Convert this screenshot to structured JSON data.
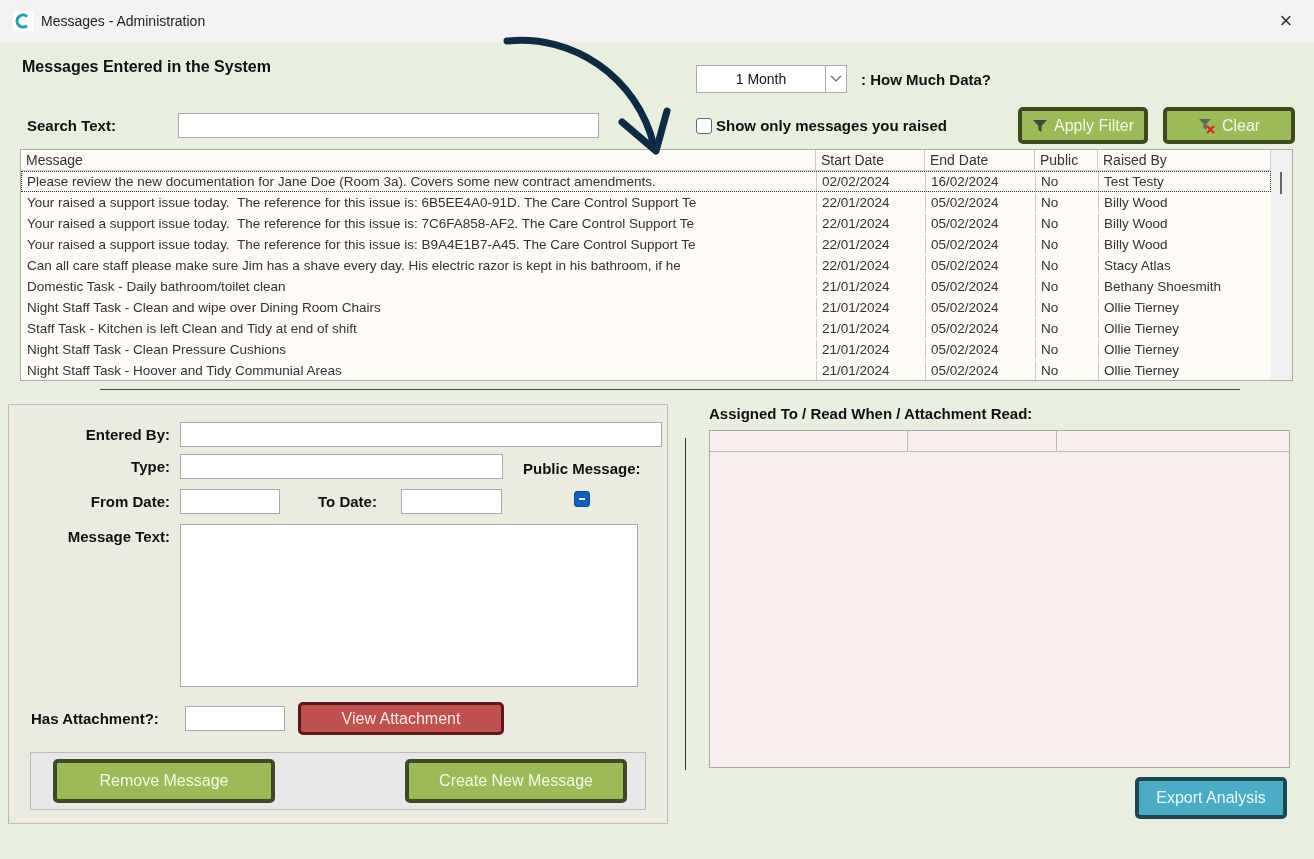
{
  "window": {
    "title": "Messages - Administration",
    "close": "×"
  },
  "header": {
    "title": "Messages Entered in the System"
  },
  "period": {
    "value": "1 Month",
    "label": ": How Much Data?"
  },
  "search": {
    "label": "Search Text:"
  },
  "only_mine": {
    "label": "Show only messages you raised",
    "checked": false
  },
  "filter_buttons": [
    {
      "kind": "apply",
      "label": "Apply Filter"
    },
    {
      "kind": "clear",
      "label": "Clear"
    }
  ],
  "table": {
    "columns": [
      "Message",
      "Start Date",
      "End Date",
      "Public",
      "Raised By"
    ],
    "rows": [
      {
        "selected": true,
        "cells": [
          "Please review the new documentation for Jane Doe (Room 3a). Covers some new contract amendments.",
          "02/02/2024",
          "16/02/2024",
          "No",
          "Test Testy"
        ]
      },
      {
        "selected": false,
        "cells": [
          "Your raised a support issue today.  The reference for this issue is: 6B5EE4A0-91D. The Care Control Support Te",
          "22/01/2024",
          "05/02/2024",
          "No",
          "Billy Wood"
        ]
      },
      {
        "selected": false,
        "cells": [
          "Your raised a support issue today.  The reference for this issue is: 7C6FA858-AF2. The Care Control Support Te",
          "22/01/2024",
          "05/02/2024",
          "No",
          "Billy Wood"
        ]
      },
      {
        "selected": false,
        "cells": [
          "Your raised a support issue today.  The reference for this issue is: B9A4E1B7-A45. The Care Control Support Te",
          "22/01/2024",
          "05/02/2024",
          "No",
          "Billy Wood"
        ]
      },
      {
        "selected": false,
        "cells": [
          "Can all care staff please make sure Jim has a shave every day. His electric razor is kept in his bathroom, if he",
          "22/01/2024",
          "05/02/2024",
          "No",
          "Stacy Atlas"
        ]
      },
      {
        "selected": false,
        "cells": [
          "Domestic Task - Daily bathroom/toilet clean",
          "21/01/2024",
          "05/02/2024",
          "No",
          "Bethany Shoesmith"
        ]
      },
      {
        "selected": false,
        "cells": [
          "Night Staff Task - Clean and wipe over Dining Room Chairs",
          "21/01/2024",
          "05/02/2024",
          "No",
          "Ollie Tierney"
        ]
      },
      {
        "selected": false,
        "cells": [
          "Staff Task - Kitchen is left Clean and Tidy at end of shift",
          "21/01/2024",
          "05/02/2024",
          "No",
          "Ollie Tierney"
        ]
      },
      {
        "selected": false,
        "cells": [
          "Night Staff Task - Clean Pressure Cushions",
          "21/01/2024",
          "05/02/2024",
          "No",
          "Ollie Tierney"
        ]
      },
      {
        "selected": false,
        "cells": [
          "Night Staff Task - Hoover and Tidy Communial Areas",
          "21/01/2024",
          "05/02/2024",
          "No",
          "Ollie Tierney"
        ]
      }
    ]
  },
  "form": {
    "entered_by": {
      "label": "Entered By:"
    },
    "type": {
      "label": "Type:"
    },
    "public_message": {
      "label": "Public Message:",
      "indeterminate": true
    },
    "from_date": {
      "label": "From Date:"
    },
    "to_date": {
      "label": "To Date:"
    },
    "message_text": {
      "label": "Message Text:"
    },
    "has_attachment": {
      "label": "Has Attachment?:"
    },
    "view_attachment": "View Attachment",
    "remove": "Remove Message",
    "create": "Create New Message"
  },
  "assigned": {
    "title": "Assigned To / Read When / Attachment Read:"
  },
  "export": "Export Analysis"
}
